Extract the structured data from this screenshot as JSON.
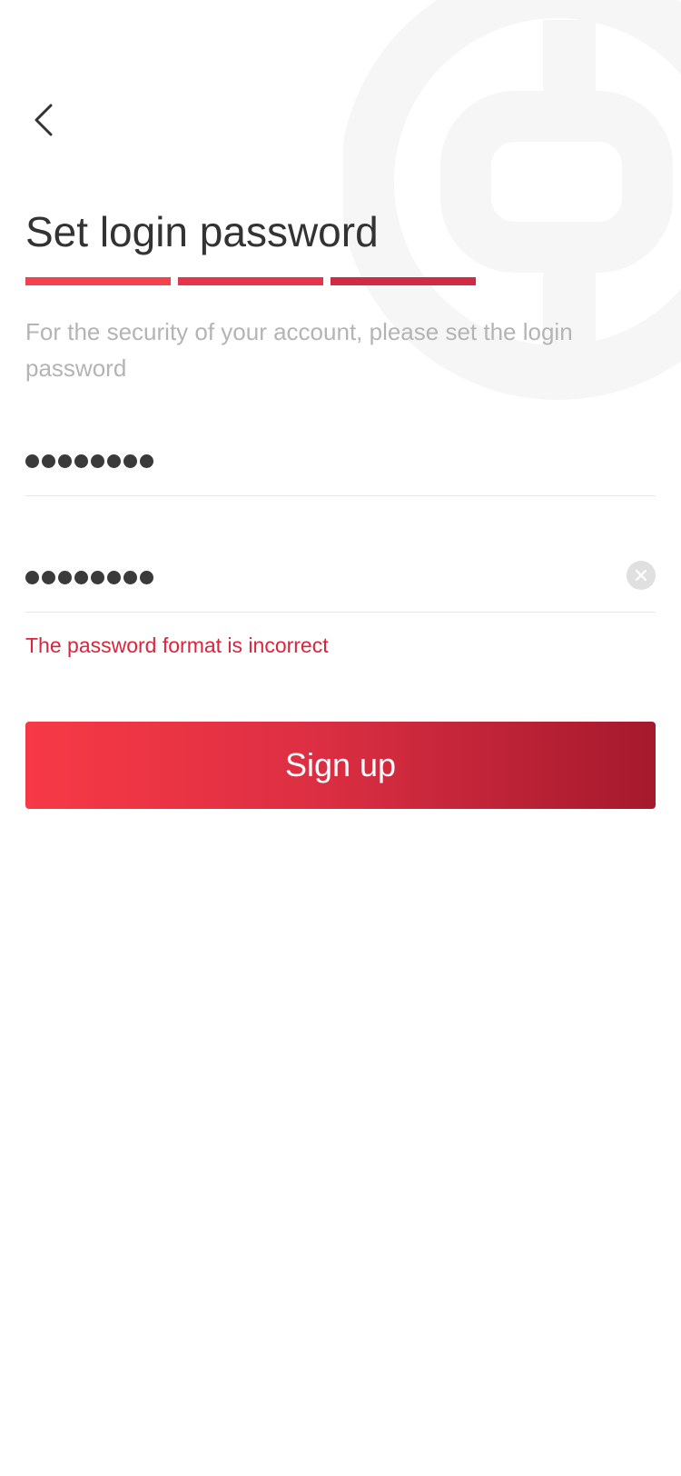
{
  "header": {
    "back_icon": "chevron-left-icon"
  },
  "title": "Set login password",
  "progress": {
    "steps_total": 3,
    "steps_completed": 3,
    "step_colors": [
      "#f5414d",
      "#e6344a",
      "#d12a45"
    ]
  },
  "subtitle": "For the security of your account, please set the login password",
  "password_field": {
    "masked_length": 8
  },
  "confirm_password_field": {
    "masked_length": 8,
    "clear_icon": "clear-circle-icon"
  },
  "error_message": "The password format is incorrect",
  "signup_button": {
    "label": "Sign up"
  },
  "colors": {
    "accent_start": "#f73946",
    "accent_end": "#a5192d",
    "error": "#d9263c",
    "watermark": "#f6f6f6"
  }
}
